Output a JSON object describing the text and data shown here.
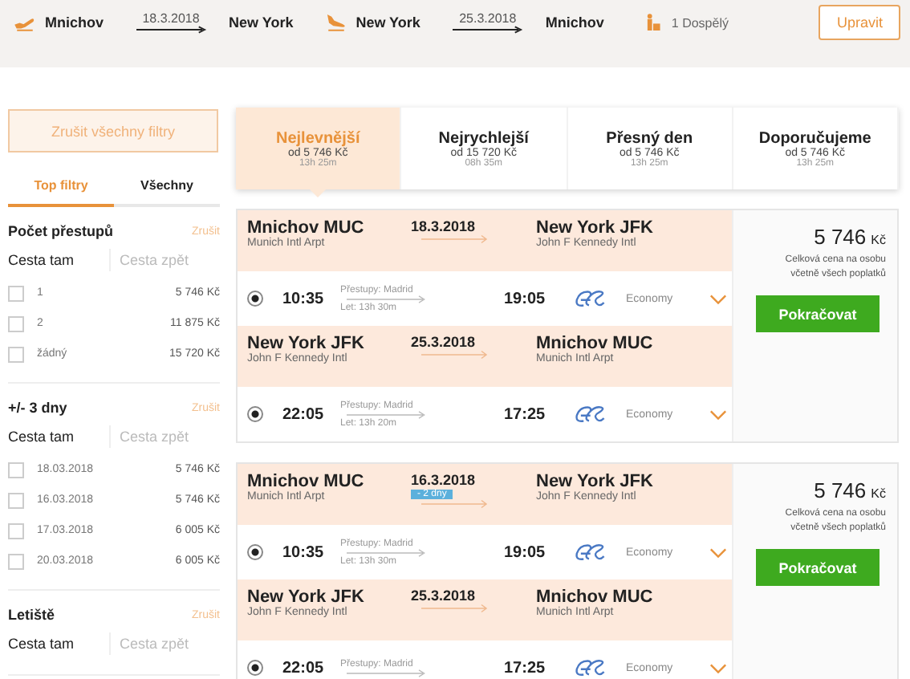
{
  "header": {
    "legs": [
      {
        "kind": "departure",
        "from": "Mnichov",
        "date": "18.3.2018",
        "to": "New York"
      },
      {
        "kind": "return",
        "from": "New York",
        "date": "25.3.2018",
        "to": "Mnichov"
      }
    ],
    "passengers": "1 Dospělý",
    "edit_button": "Upravit"
  },
  "sidebar": {
    "clear_button": "Zrušit všechny filtry",
    "tabs": [
      {
        "label": "Top filtry",
        "selected": true
      },
      {
        "label": "Všechny",
        "selected": false
      }
    ],
    "sections": [
      {
        "title": "Počet přestupů",
        "clear": "Zrušit",
        "direction_tabs": [
          {
            "label": "Cesta tam",
            "selected": true
          },
          {
            "label": "Cesta zpět",
            "selected": false
          }
        ],
        "options": [
          {
            "label": "1",
            "price": "5 746 Kč",
            "checked": false
          },
          {
            "label": "2",
            "price": "11 875 Kč",
            "checked": false
          },
          {
            "label": "žádný",
            "price": "15 720 Kč",
            "checked": false
          }
        ]
      },
      {
        "title": "+/- 3 dny",
        "clear": "Zrušit",
        "direction_tabs": [
          {
            "label": "Cesta tam",
            "selected": true
          },
          {
            "label": "Cesta zpět",
            "selected": false
          }
        ],
        "options": [
          {
            "label": "18.03.2018",
            "price": "5 746 Kč",
            "checked": false
          },
          {
            "label": "16.03.2018",
            "price": "5 746 Kč",
            "checked": false
          },
          {
            "label": "17.03.2018",
            "price": "6 005 Kč",
            "checked": false
          },
          {
            "label": "20.03.2018",
            "price": "6 005 Kč",
            "checked": false
          }
        ]
      },
      {
        "title": "Letiště",
        "clear": "Zrušit",
        "direction_tabs": [
          {
            "label": "Cesta tam",
            "selected": true
          },
          {
            "label": "Cesta zpět",
            "selected": false
          }
        ]
      }
    ]
  },
  "sort_tabs": [
    {
      "label": "Nejlevnější",
      "price": "od 5 746 Kč",
      "duration": "13h 25m",
      "selected": true
    },
    {
      "label": "Nejrychlejší",
      "price": "od 15 720 Kč",
      "duration": "08h 35m",
      "selected": false
    },
    {
      "label": "Přesný den",
      "price": "od 5 746 Kč",
      "duration": "13h 25m",
      "selected": false
    },
    {
      "label": "Doporučujeme",
      "price": "od 5 746 Kč",
      "duration": "13h 25m",
      "selected": false
    }
  ],
  "results": [
    {
      "legs": [
        {
          "from": "Mnichov MUC",
          "from_airport": "Munich Intl Arpt",
          "date": "18.3.2018",
          "to": "New York JFK",
          "to_airport": "John F Kennedy Intl",
          "depart_time": "10:35",
          "stops": "Přestupy: Madrid",
          "duration": "Let: 13h 30m",
          "arrive_time": "19:05",
          "cabin": "Economy",
          "selected": true
        },
        {
          "from": "New York JFK",
          "from_airport": "John F Kennedy Intl",
          "date": "25.3.2018",
          "to": "Mnichov MUC",
          "to_airport": "Munich Intl Arpt",
          "depart_time": "22:05",
          "stops": "Přestupy: Madrid",
          "duration": "Let: 13h 20m",
          "arrive_time": "17:25",
          "cabin": "Economy",
          "selected": true
        }
      ],
      "price": "5 746",
      "currency": "Kč",
      "price_note": "Celková cena na osobu včetně všech poplatků",
      "button": "Pokračovat"
    },
    {
      "legs": [
        {
          "from": "Mnichov MUC",
          "from_airport": "Munich Intl Arpt",
          "date": "16.3.2018",
          "shift": "- 2 dny",
          "to": "New York JFK",
          "to_airport": "John F Kennedy Intl",
          "depart_time": "10:35",
          "stops": "Přestupy: Madrid",
          "duration": "Let: 13h 30m",
          "arrive_time": "19:05",
          "cabin": "Economy",
          "selected": true
        },
        {
          "from": "New York JFK",
          "from_airport": "John F Kennedy Intl",
          "date": "25.3.2018",
          "to": "Mnichov MUC",
          "to_airport": "Munich Intl Arpt",
          "depart_time": "22:05",
          "stops": "Přestupy: Madrid",
          "arrive_time": "17:25",
          "cabin": "Economy",
          "selected": true
        }
      ],
      "price": "5 746",
      "currency": "Kč",
      "price_note": "Celková cena na osobu včetně všech poplatků",
      "button": "Pokračovat"
    }
  ]
}
